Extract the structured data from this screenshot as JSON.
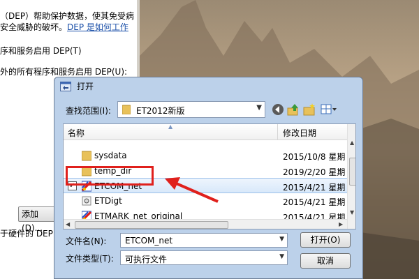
{
  "background_window": {
    "lines": [
      "（DEP）帮助保护数据，使其免受病",
      "安全威胁的破坏。",
      "序和服务启用 DEP(T)",
      "外的所有程序和服务启用 DEP(U):",
      "于硬件的 DEP"
    ],
    "link_text": "DEP 是如何工作",
    "add_button": "添加(D)..."
  },
  "dialog": {
    "title": "打开",
    "look_in_label": "查找范围(I):",
    "look_in_value": "ET2012新版",
    "columns": {
      "name": "名称",
      "date": "修改日期"
    },
    "files": [
      {
        "name": "sysdata",
        "date": "2015/10/8 星期",
        "icon": "folder-icon"
      },
      {
        "name": "temp_dir",
        "date": "2019/2/20 星期",
        "icon": "folder-icon"
      },
      {
        "name": "ETCOM_net",
        "date": "2015/4/21 星期",
        "icon": "exe-icon",
        "selected": true
      },
      {
        "name": "ETDigt",
        "date": "2015/4/21 星期",
        "icon": "app-icon"
      },
      {
        "name": "ETMARK_net_original",
        "date": "2015/4/21 星期",
        "icon": "exe-icon"
      }
    ],
    "file_name_label": "文件名(N):",
    "file_name_value": "ETCOM_net",
    "file_type_label": "文件类型(T):",
    "file_type_value": "可执行文件",
    "open_button": "打开(O)",
    "cancel_button": "取消"
  },
  "colors": {
    "annotation_red": "#e0201c",
    "dialog_frame": "#bcd1ea",
    "link_blue": "#1a4fa8"
  }
}
